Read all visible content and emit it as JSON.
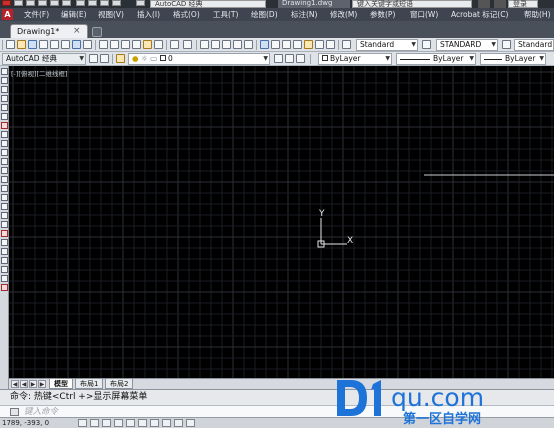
{
  "titlebar": {
    "workspace": "AutoCAD 经典",
    "drawing_name": "Drawing1.dwg",
    "search_placeholder": "键入关键字或短语",
    "login": "登录"
  },
  "menu": {
    "items": [
      "文件(F)",
      "编辑(E)",
      "视图(V)",
      "插入(I)",
      "格式(O)",
      "工具(T)",
      "绘图(D)",
      "标注(N)",
      "修改(M)",
      "参数(P)",
      "窗口(W)",
      "Acrobat 标记(C)",
      "帮助(H)"
    ]
  },
  "tabs": {
    "active": "Drawing1*",
    "close": "×"
  },
  "toolbar1": {
    "text_style": "Standard",
    "dim_style": "STANDARD",
    "table_style": "Standard"
  },
  "toolbar2": {
    "workspace": "AutoCAD 经典",
    "layer": "0",
    "color": "ByLayer",
    "linetype": "ByLayer",
    "lineweight": "ByLayer"
  },
  "canvas": {
    "viewport_label": "[-][俯视][二维线框]",
    "ucs_y": "Y",
    "ucs_x": "X"
  },
  "layout": {
    "tabs": [
      "模型",
      "布局1",
      "布局2"
    ],
    "active": "模型",
    "nav": [
      "◀",
      "◀",
      "▶",
      "▶"
    ]
  },
  "command": {
    "history": "命令: 热键<Ctrl +>显示屏幕菜单",
    "placeholder": "键入命令"
  },
  "status": {
    "coords": "1789, -393, 0"
  },
  "watermark": {
    "brand": "D1qu.com",
    "tagline": "第一区自学网"
  },
  "colors": {
    "canvas_bg": "#000000",
    "grid_minor": "#1a1d22",
    "grid_major": "#2c3139",
    "watermark_blue": "#1e73d8",
    "menu_bg": "#3f4550"
  }
}
